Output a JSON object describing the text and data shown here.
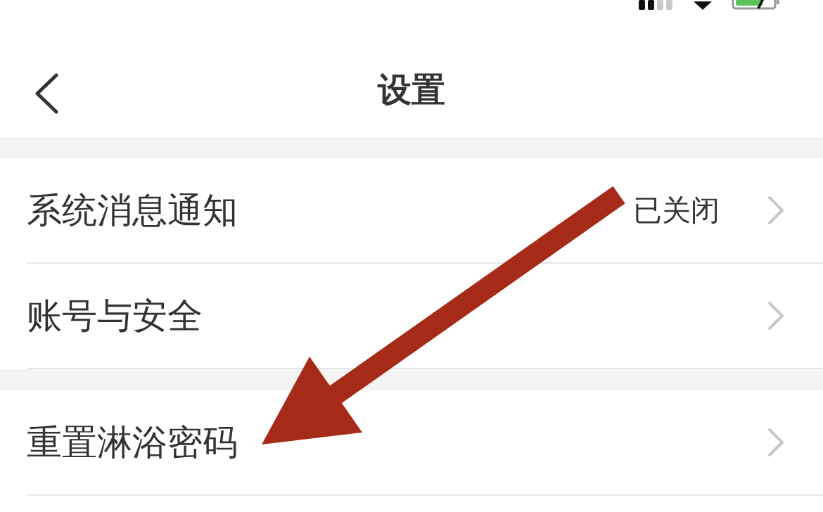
{
  "nav": {
    "title": "设置"
  },
  "groups": [
    {
      "rows": [
        {
          "label": "系统消息通知",
          "value": "已关闭"
        },
        {
          "label": "账号与安全"
        }
      ]
    },
    {
      "rows": [
        {
          "label": "重置淋浴密码"
        }
      ]
    }
  ]
}
